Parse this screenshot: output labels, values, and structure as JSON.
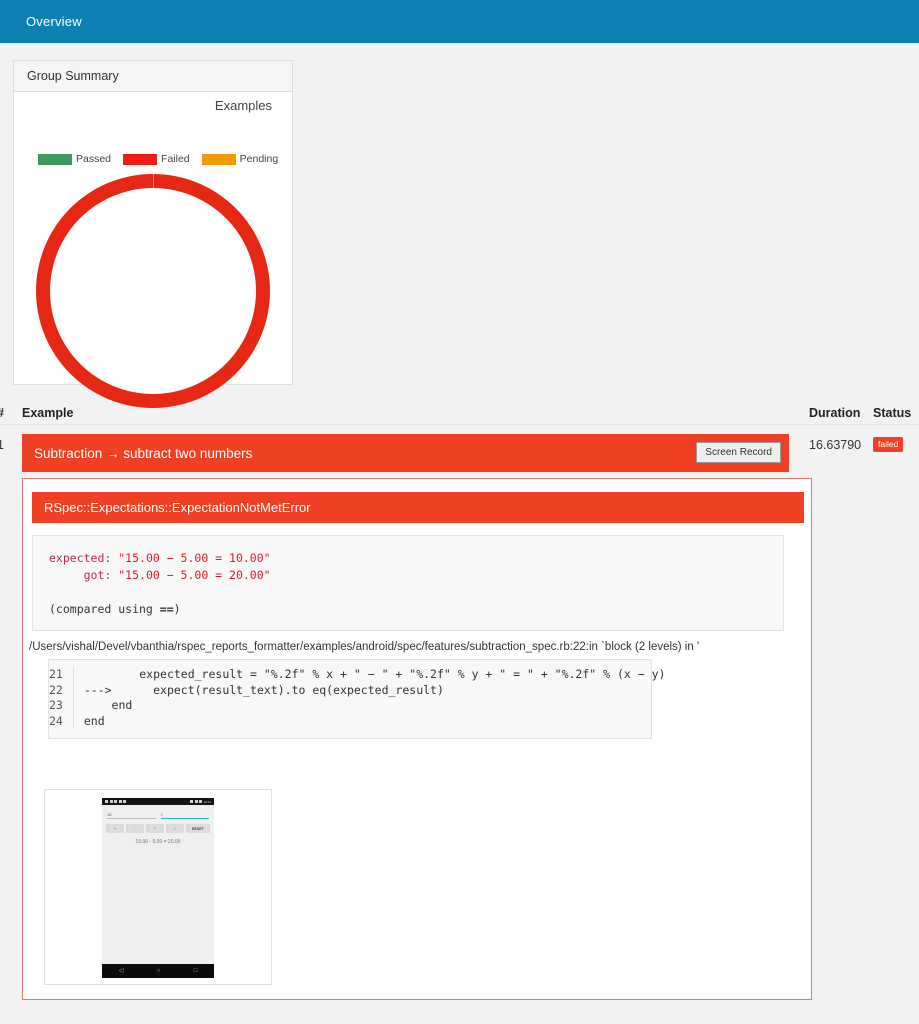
{
  "topnav": {
    "tab_label": "Overview"
  },
  "summary": {
    "card_title": "Group Summary",
    "chart_title": "Examples",
    "legend": [
      {
        "label": "Passed",
        "color": "#3c9a5f"
      },
      {
        "label": "Failed",
        "color": "#ed1c16"
      },
      {
        "label": "Pending",
        "color": "#ef9a06"
      }
    ]
  },
  "chart_data": {
    "type": "pie",
    "title": "Examples",
    "categories": [
      "Passed",
      "Failed",
      "Pending"
    ],
    "values": [
      0,
      1,
      0
    ],
    "colors": [
      "#3c9a5f",
      "#e52713",
      "#ef9a06"
    ],
    "donut": true,
    "inner_radius_ratio": 0.44,
    "legend_position": "top",
    "xlabel": "",
    "ylabel": ""
  },
  "table": {
    "headers": {
      "number": "#",
      "example": "Example",
      "duration": "Duration",
      "status": "Status"
    },
    "rows": [
      {
        "number": "1",
        "example": "Subtraction → subtract two numbers",
        "record_button": "Screen Record",
        "duration": "16.63790",
        "status": "failed"
      }
    ]
  },
  "detail": {
    "error_title": "RSpec::Expectations::ExpectationNotMetError",
    "message": {
      "expected_label": "expected: ",
      "expected_value": "\"15.00 − 5.00 = 10.00\"",
      "got_label": "     got: ",
      "got_value": "\"15.00 − 5.00 = 20.00\"",
      "compared_prefix": "(compared using ",
      "compared_op": "==",
      "compared_suffix": ")"
    },
    "file_path": "/Users/vishal/Devel/vbanthia/rspec_reports_formatter/examples/android/spec/features/subtraction_spec.rb:22:in `block (2 levels) in '",
    "code": {
      "line_numbers": [
        "21",
        "22",
        "23",
        "24"
      ],
      "lines": [
        "        expected_result = \"%.2f\" % x + \" − \" + \"%.2f\" % y + \" = \" + \"%.2f\" % (x − y)",
        "--->      expect(result_text).to eq(expected_result)",
        "    end",
        "end"
      ]
    }
  },
  "screenshot": {
    "status_clock": "10:11",
    "input_left": "15",
    "input_right": "5",
    "buttons": [
      "+",
      "-",
      "*",
      "/",
      "RESET"
    ],
    "result_text": "15.00 - 5.00 = 20.00",
    "nav_back": "◁",
    "nav_home": "○",
    "nav_recent": "□"
  },
  "colors": {
    "nav_blue": "#0d81b4",
    "failed_red": "#ef4024",
    "donut_red": "#e52713",
    "page_bg": "#f2f2f2"
  }
}
